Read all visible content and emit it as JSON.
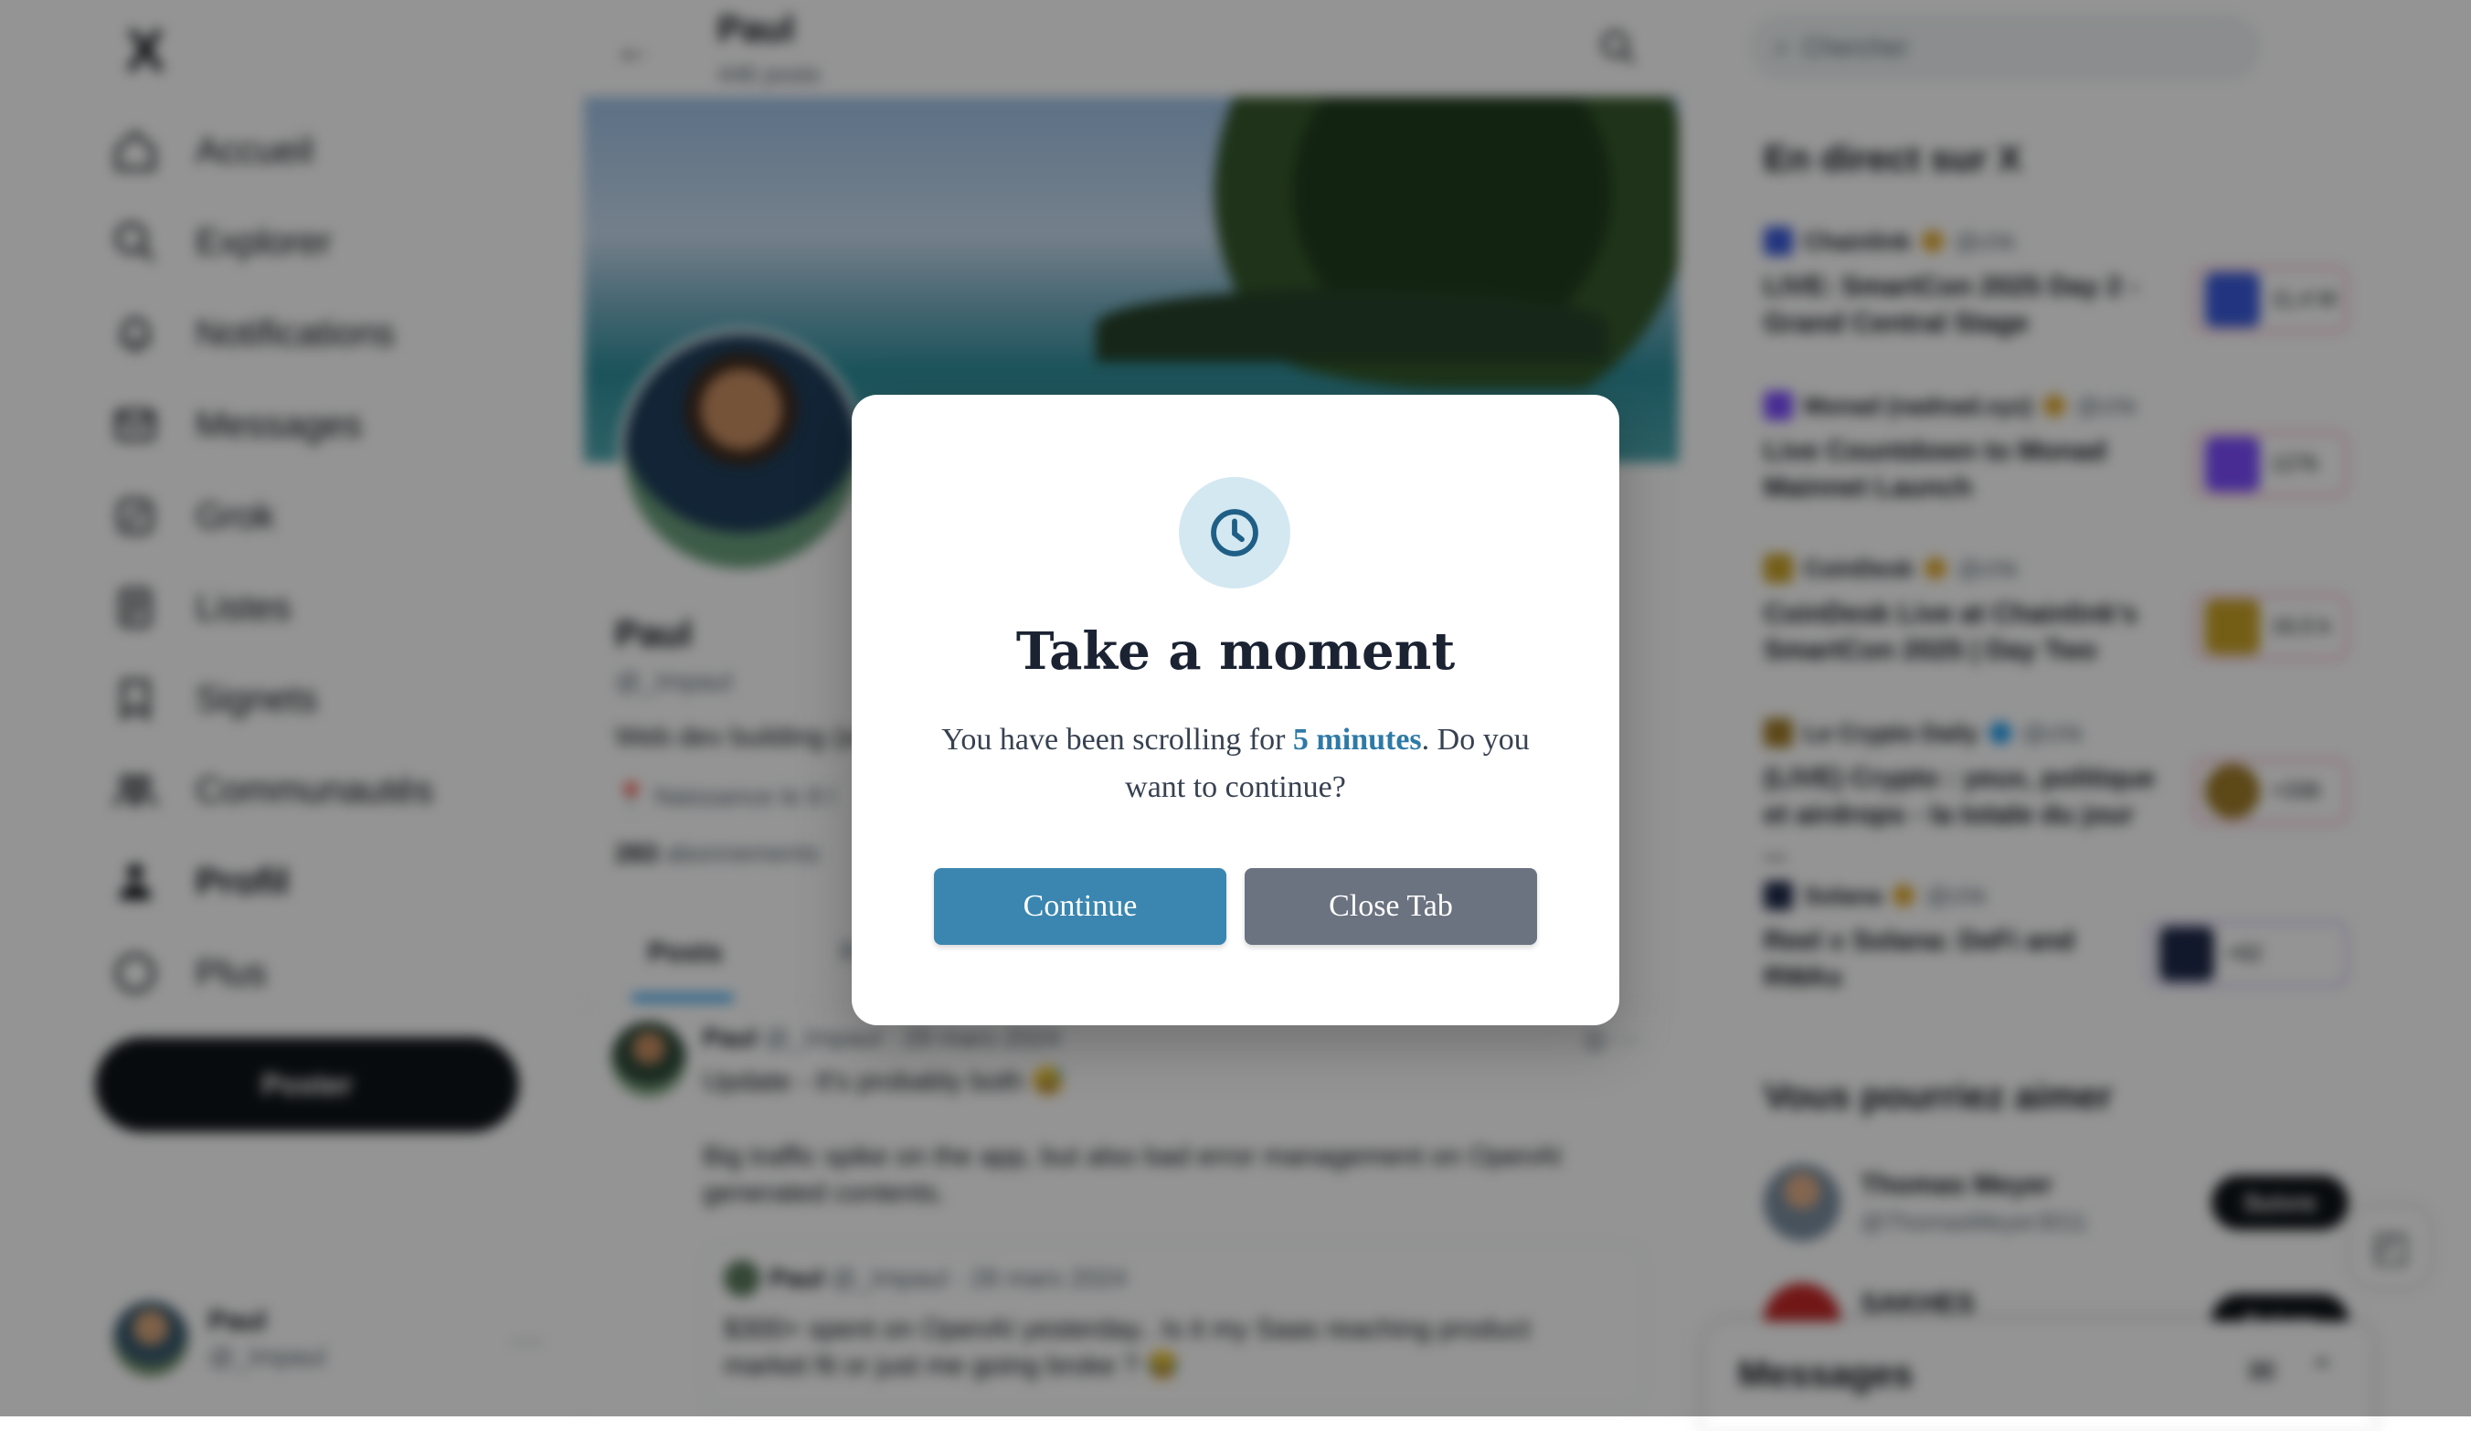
{
  "sidebar": {
    "logo": "X",
    "items": [
      {
        "label": "Accueil",
        "icon": "home-icon"
      },
      {
        "label": "Explorer",
        "icon": "search-icon"
      },
      {
        "label": "Notifications",
        "icon": "bell-icon"
      },
      {
        "label": "Messages",
        "icon": "mail-icon"
      },
      {
        "label": "Grok",
        "icon": "grok-icon"
      },
      {
        "label": "Listes",
        "icon": "list-icon"
      },
      {
        "label": "Signets",
        "icon": "bookmark-icon"
      },
      {
        "label": "Communautés",
        "icon": "people-icon"
      },
      {
        "label": "Profil",
        "icon": "person-icon"
      },
      {
        "label": "Plus",
        "icon": "more-circle-icon"
      }
    ],
    "post_button": "Poster",
    "account": {
      "name": "Paul",
      "handle": "@_Impaul",
      "more": "···"
    }
  },
  "profile": {
    "header_name": "Paul",
    "header_posts": "446 posts",
    "name": "Paul",
    "handle": "@_Impaul",
    "bio": "Web dev building (a",
    "location": "Naissance le 8 l",
    "following_count": "283",
    "following_label": "abonnements",
    "tabs": [
      "Posts",
      "R"
    ]
  },
  "post": {
    "author": "Paul",
    "meta": "@_Impaul · 29 mars 2024",
    "line1": "Update - It's probably both 😅",
    "line2": "Big traffic spike on the app, but also bad error management on OpenAI generated contents.",
    "quote": {
      "author": "Paul",
      "meta": "@_Impaul · 28 mars 2024",
      "text": "$300+ spent on OpenAI yesterday.. Is it my Saas reaching product market fit or just me going broke ? 😂"
    }
  },
  "right": {
    "search_placeholder": "Chercher",
    "live_title": "En direct sur X",
    "live": [
      {
        "host": "Chainlink",
        "time": "@chk",
        "title": "LIVE: SmartCon 2025 Day 2 - Grand Central Stage",
        "count": "11,4 M",
        "color": "#3b5bdb"
      },
      {
        "host": "Monad (nadnad.xyz)",
        "time": "@chk",
        "title": "Live Countdown to Monad Mainnet Launch",
        "count": "127k",
        "color": "#7c4dff"
      },
      {
        "host": "CoinDesk",
        "time": "@chk",
        "title": "CoinDesk Live at Chainlink's SmartCon 2025 | Day Two",
        "count": "16,5 k",
        "color": "#c9a227"
      },
      {
        "host": "Le Crypto Daily",
        "time": "@chk",
        "title": "(LIVE) Crypto : yeux, politique et airdrops - la totale du jour ...",
        "count": "+336",
        "color": "#a07c2a"
      },
      {
        "host": "Solana",
        "time": "@chk",
        "title": "Reel x Solana: DeFi and RWAs",
        "count": "+62",
        "color": "#1f2a4a"
      }
    ],
    "suggest_title": "Vous pourriez aimer",
    "suggestions": [
      {
        "name": "Thomas Meyer",
        "handle": "@ThomasMeyer3011",
        "button": "Suivre"
      },
      {
        "name": "SAKHES",
        "handle": "",
        "button": "Suivre"
      }
    ],
    "messages_title": "Messages"
  },
  "modal": {
    "title": "Take a moment",
    "message_before": "You have been scrolling for ",
    "message_highlight": "5 minutes",
    "message_after": ". Do you want to continue?",
    "continue_label": "Continue",
    "close_label": "Close Tab",
    "icon": "clock-icon",
    "colors": {
      "accent": "#3a86b0",
      "secondary": "#6b7280",
      "icon_bg": "#d4e8f2"
    }
  }
}
